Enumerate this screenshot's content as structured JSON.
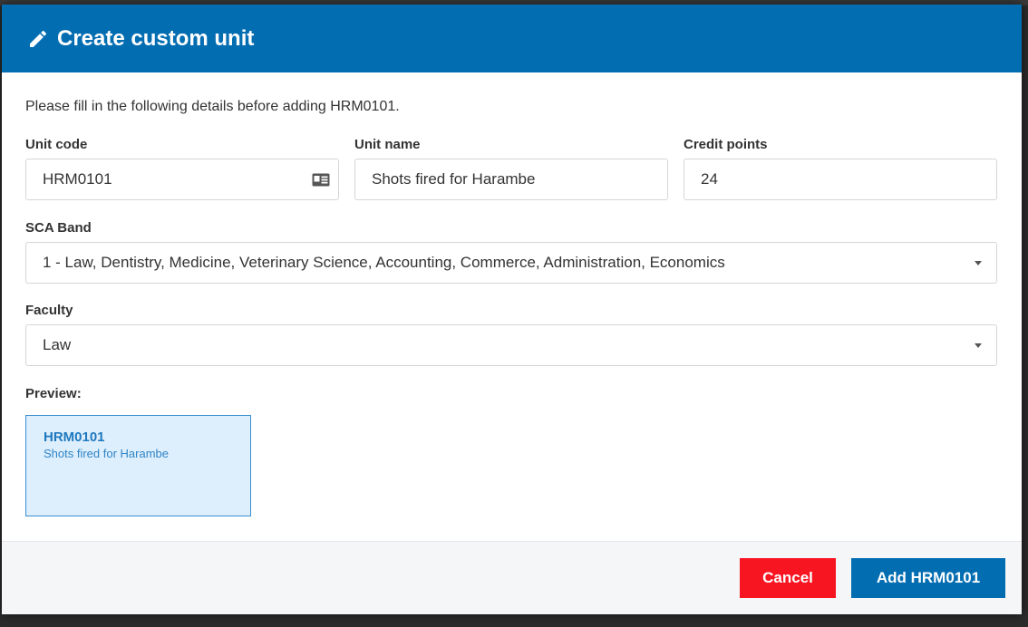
{
  "modal": {
    "title": "Create custom unit",
    "intro": "Please fill in the following details before adding HRM0101."
  },
  "fields": {
    "unit_code": {
      "label": "Unit code",
      "value": "HRM0101"
    },
    "unit_name": {
      "label": "Unit name",
      "value": "Shots fired for Harambe"
    },
    "credit_points": {
      "label": "Credit points",
      "value": "24"
    },
    "sca_band": {
      "label": "SCA Band",
      "value": "1 - Law, Dentistry, Medicine, Veterinary Science, Accounting, Commerce, Administration, Economics"
    },
    "faculty": {
      "label": "Faculty",
      "value": "Law"
    }
  },
  "preview": {
    "label": "Preview:",
    "code": "HRM0101",
    "name": "Shots fired for Harambe"
  },
  "footer": {
    "cancel_label": "Cancel",
    "add_label": "Add HRM0101"
  },
  "colors": {
    "header": "#036db2",
    "cancel": "#f81522",
    "add": "#036db2",
    "preview_bg": "#ddeefc"
  },
  "icons": {
    "title_icon": "pencil-icon",
    "unit_code_icon": "id-card-icon",
    "dropdown_icon": "caret-down-icon"
  }
}
